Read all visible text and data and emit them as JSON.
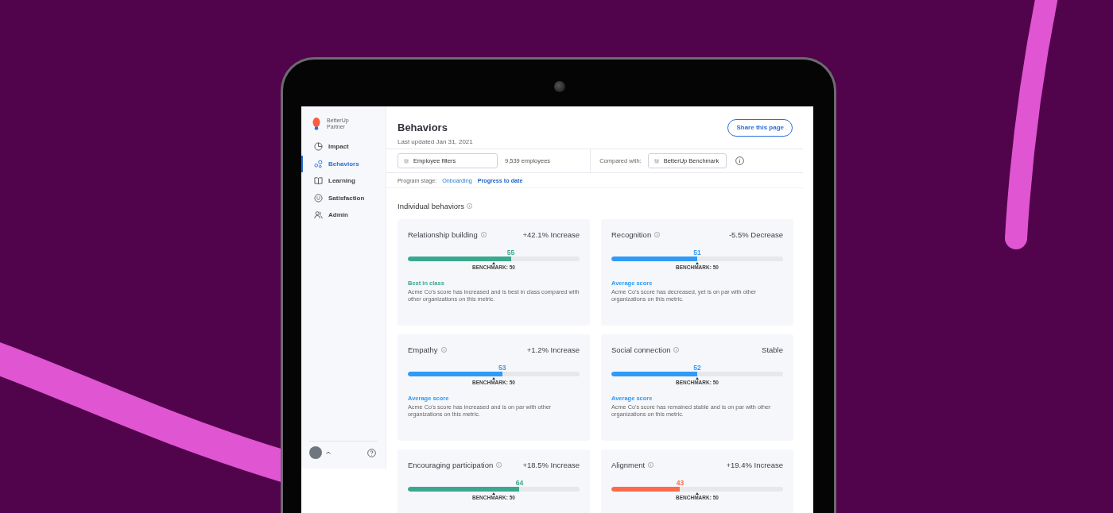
{
  "sidebar": {
    "brand": {
      "name": "BetterUp",
      "subtitle": "Partner"
    },
    "items": [
      {
        "label": "Impact",
        "selected": false
      },
      {
        "label": "Behaviors",
        "selected": true
      },
      {
        "label": "Learning",
        "selected": false
      },
      {
        "label": "Satisfaction",
        "selected": false
      },
      {
        "label": "Admin",
        "selected": false
      }
    ]
  },
  "header": {
    "title": "Behaviors",
    "subtitle": "Last updated Jan 31, 2021",
    "share_button": "Share this page"
  },
  "filters": {
    "employee_filter": {
      "value": "Employee filters"
    },
    "count": "9,539 employees",
    "compared_label": "Compared with:",
    "benchmark_filter": {
      "value": "BetterUp Benchmark"
    }
  },
  "program_stage": {
    "label": "Program stage:",
    "options": [
      {
        "label": "Onboarding",
        "selected": false
      },
      {
        "label": "Progress to date",
        "selected": true
      }
    ]
  },
  "section_title": "Individual behaviors",
  "cards": [
    {
      "title": "Relationship building",
      "change": "+42.1% Increase",
      "score": "55",
      "level": 0.6,
      "color": "#3aa88f",
      "benchmark": "BENCHMARK: 50",
      "footer_title": "Best in class",
      "description": "Acme Co's score has increased and is best in class compared with other organizations on this metric."
    },
    {
      "title": "Recognition",
      "change": "-5.5% Decrease",
      "score": "51",
      "level": 0.5,
      "color": "#2f9bf7",
      "benchmark": "BENCHMARK: 50",
      "footer_title": "Average score",
      "description": "Acme Co's score has decreased, yet is on par with other organizations on this metric."
    },
    {
      "title": "Empathy",
      "change": "+1.2% Increase",
      "score": "53",
      "level": 0.55,
      "color": "#2f9bf7",
      "benchmark": "BENCHMARK: 50",
      "footer_title": "Average score",
      "description": "Acme Co's score has increased and is on par with other organizations on this metric."
    },
    {
      "title": "Social connection",
      "change": "Stable",
      "score": "52",
      "level": 0.5,
      "color": "#2f9bf7",
      "benchmark": "BENCHMARK: 50",
      "footer_title": "Average score",
      "description": "Acme Co's score has remained stable and is on par with other organizations on this metric."
    },
    {
      "title": "Encouraging participation",
      "change": "+18.5% Increase",
      "score": "64",
      "level": 0.65,
      "color": "#3aa88f",
      "benchmark": "BENCHMARK: 50"
    },
    {
      "title": "Alignment",
      "change": "+19.4% Increase",
      "score": "43",
      "level": 0.4,
      "color": "#ff6a4b",
      "benchmark": "BENCHMARK: 50"
    }
  ]
}
